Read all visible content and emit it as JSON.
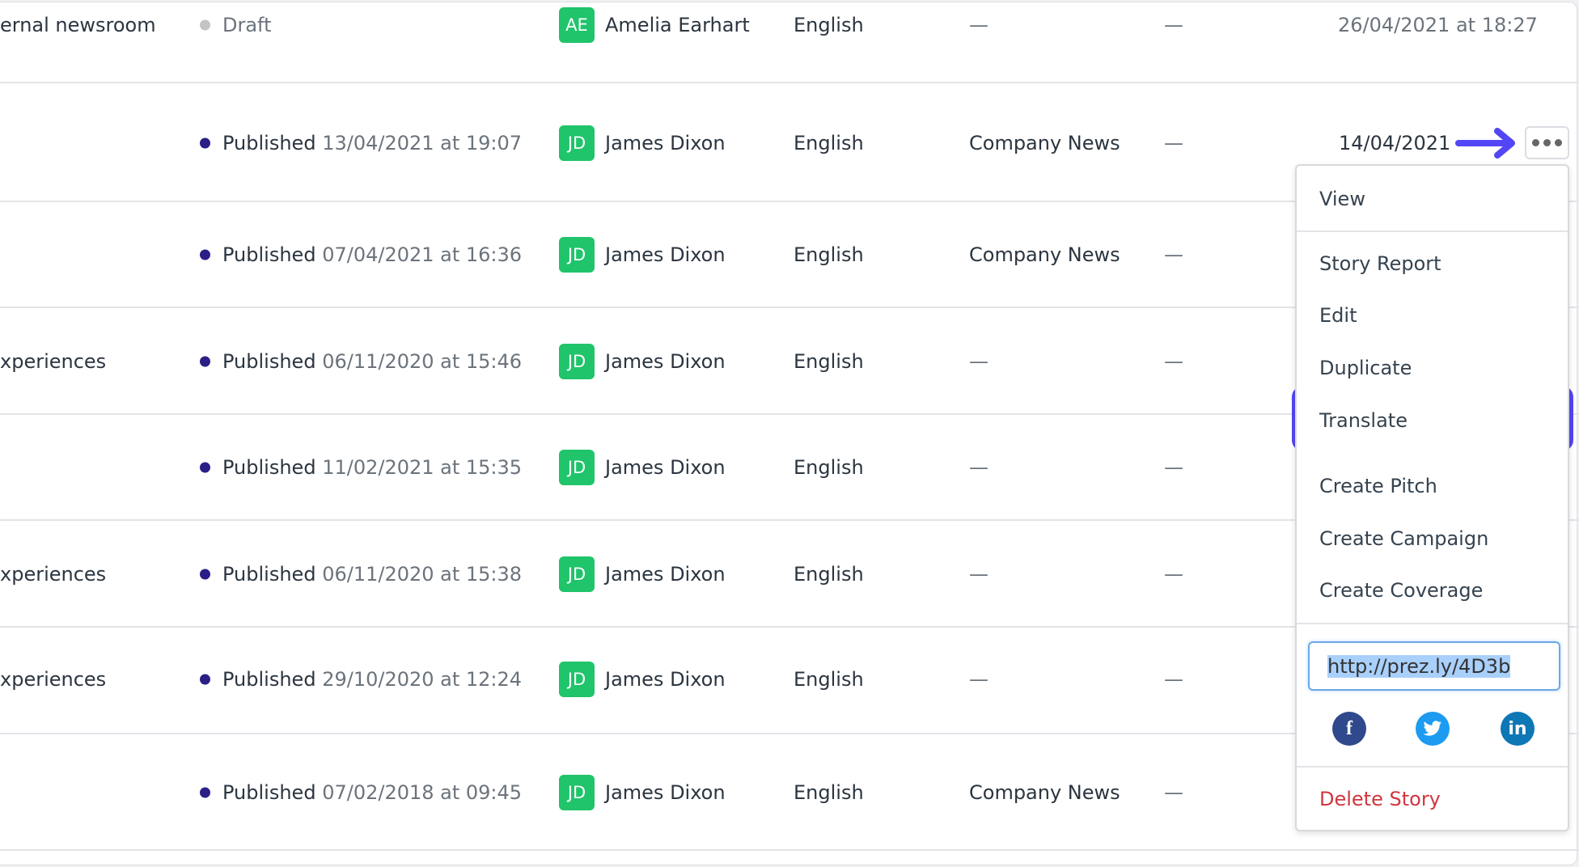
{
  "rows": [
    {
      "title": "ernal newsroom",
      "status": "Draft",
      "status_date": "",
      "status_color": "#c4c4c4",
      "initials": "AE",
      "author": "Amelia Earhart",
      "language": "English",
      "category": "—",
      "extra": "—",
      "date": "26/04/2021 at 18:27"
    },
    {
      "title": "",
      "status": "Published",
      "status_date": "13/04/2021 at 19:07",
      "status_color": "#2a1f86",
      "initials": "JD",
      "author": "James Dixon",
      "language": "English",
      "category": "Company News",
      "extra": "—",
      "date": "14/04/2021"
    },
    {
      "title": "",
      "status": "Published",
      "status_date": "07/04/2021 at 16:36",
      "status_color": "#2a1f86",
      "initials": "JD",
      "author": "James Dixon",
      "language": "English",
      "category": "Company News",
      "extra": "—",
      "date": ""
    },
    {
      "title": "xperiences",
      "status": "Published",
      "status_date": "06/11/2020 at 15:46",
      "status_color": "#2a1f86",
      "initials": "JD",
      "author": "James Dixon",
      "language": "English",
      "category": "—",
      "extra": "—",
      "date": ""
    },
    {
      "title": "",
      "status": "Published",
      "status_date": "11/02/2021 at 15:35",
      "status_color": "#2a1f86",
      "initials": "JD",
      "author": "James Dixon",
      "language": "English",
      "category": "—",
      "extra": "—",
      "date": ""
    },
    {
      "title": "xperiences",
      "status": "Published",
      "status_date": "06/11/2020 at 15:38",
      "status_color": "#2a1f86",
      "initials": "JD",
      "author": "James Dixon",
      "language": "English",
      "category": "—",
      "extra": "—",
      "date": ""
    },
    {
      "title": "xperiences",
      "status": "Published",
      "status_date": "29/10/2020 at 12:24",
      "status_color": "#2a1f86",
      "initials": "JD",
      "author": "James Dixon",
      "language": "English",
      "category": "—",
      "extra": "—",
      "date": ""
    },
    {
      "title": "",
      "status": "Published",
      "status_date": "07/02/2018 at 09:45",
      "status_color": "#2a1f86",
      "initials": "JD",
      "author": "James Dixon",
      "language": "English",
      "category": "Company News",
      "extra": "—",
      "date": ""
    }
  ],
  "menu": {
    "items": [
      "View",
      "Story Report",
      "Edit",
      "Duplicate",
      "Translate",
      "Create Pitch",
      "Create Campaign",
      "Create Coverage"
    ],
    "highlighted": "Translate",
    "short_url": "http://prez.ly/4D3b",
    "social": [
      "facebook-icon",
      "twitter-icon",
      "linkedin-icon"
    ],
    "delete": "Delete Story"
  },
  "colors": {
    "accent": "#5346f5",
    "avatar": "#1fc46b",
    "danger": "#d0363f",
    "facebook": "#30498c",
    "twitter": "#1d9bf0",
    "linkedin": "#0e77b5"
  }
}
